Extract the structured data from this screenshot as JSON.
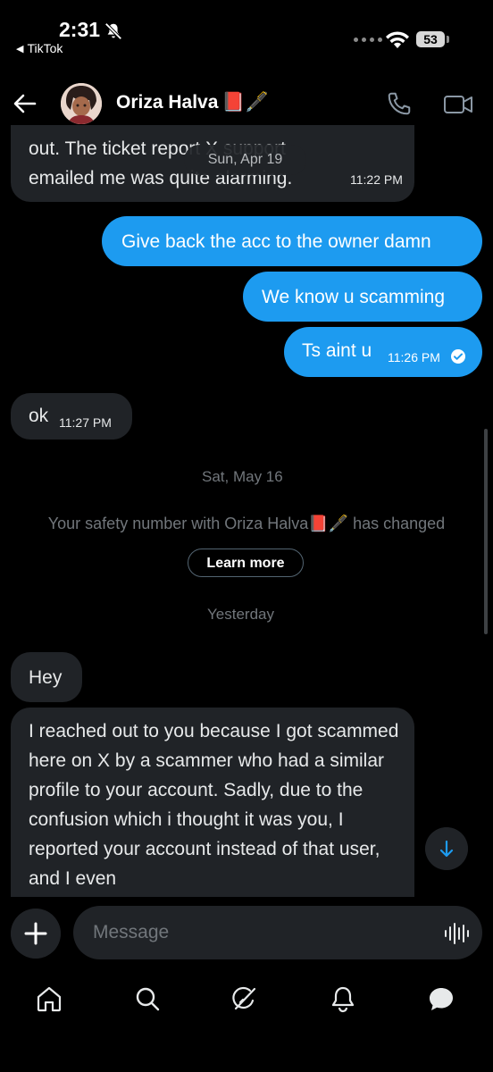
{
  "status_bar": {
    "time": "2:31",
    "back_app": "TikTok",
    "battery": "53"
  },
  "header": {
    "contact_name": "Oriza Halva",
    "name_emojis": "📕🖋️"
  },
  "sticky_date": "Sun, Apr 19",
  "messages": [
    {
      "dir": "in",
      "text": "out. The ticket report X support\nemailed me was quite alarming.",
      "time": "11:22 PM"
    },
    {
      "dir": "out",
      "text": "Give back the acc to the owner damn"
    },
    {
      "dir": "out",
      "text": "We know u scamming"
    },
    {
      "dir": "out",
      "text": "Ts aint u",
      "time": "11:26 PM",
      "read": true
    },
    {
      "dir": "in",
      "text": "ok",
      "time": "11:27 PM"
    }
  ],
  "date_may": "Sat, May 16",
  "safety_notice": {
    "prefix": "Your safety number with Oriza Halva",
    "emojis": "📕🖋️",
    "suffix": "has changed",
    "button": "Learn more"
  },
  "date_yesterday": "Yesterday",
  "recent_messages": [
    {
      "dir": "in",
      "text": "Hey"
    },
    {
      "dir": "in",
      "text": "I reached out to you because I got scammed here on X by a scammer who had a similar profile to your account. Sadly, due to the confusion which i thought it was you, I reported your account instead of that user, and I even"
    }
  ],
  "composer": {
    "placeholder": "Message"
  },
  "colors": {
    "accent": "#1d9bf0",
    "bubble_in": "#202327",
    "muted": "#71767b"
  },
  "nav": [
    "home-icon",
    "search-icon",
    "grok-icon",
    "notifications-icon",
    "messages-icon"
  ]
}
